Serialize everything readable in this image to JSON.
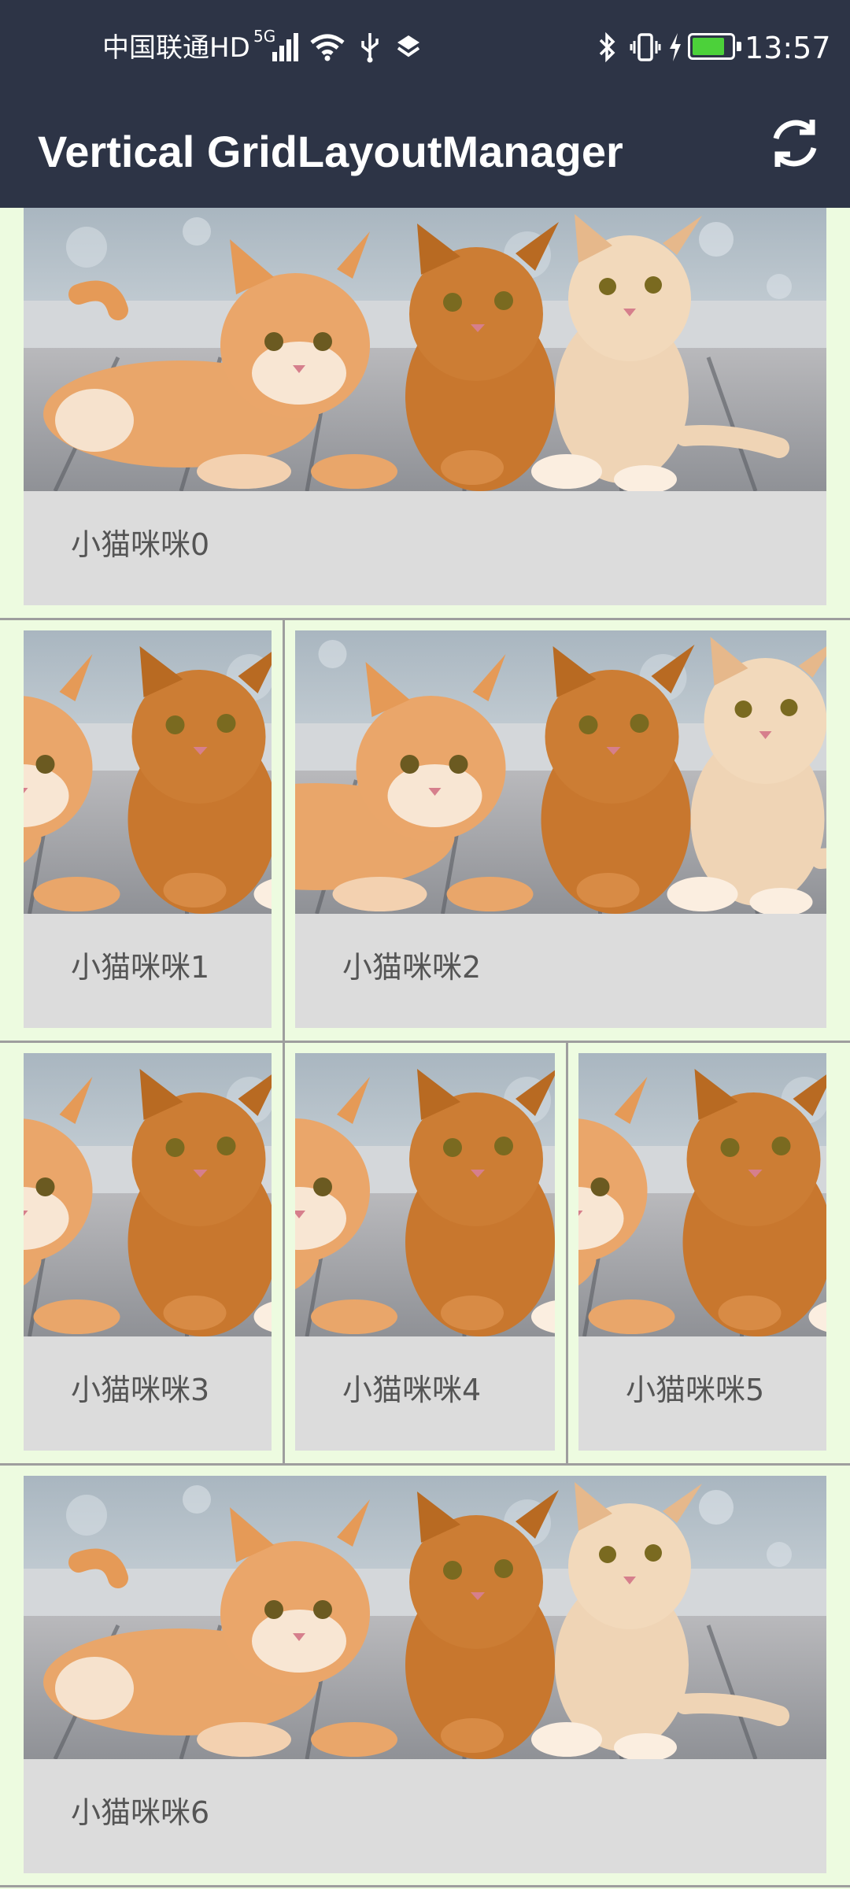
{
  "status_bar": {
    "carrier": "中国联通HD",
    "network": "5G",
    "time": "13:57",
    "battery_color": "#4cd13a",
    "icons": [
      "signal-icon",
      "wifi-icon",
      "usb-icon",
      "layers-icon",
      "bluetooth-icon",
      "vibrate-icon",
      "charging-icon",
      "battery-icon"
    ]
  },
  "toolbar": {
    "title": "Vertical GridLayoutManager",
    "refresh_icon": "refresh-icon"
  },
  "grid": {
    "items": [
      {
        "label": "小猫咪咪0"
      },
      {
        "label": "小猫咪咪1"
      },
      {
        "label": "小猫咪咪2"
      },
      {
        "label": "小猫咪咪3"
      },
      {
        "label": "小猫咪咪4"
      },
      {
        "label": "小猫咪咪5"
      },
      {
        "label": "小猫咪咪6"
      }
    ]
  },
  "colors": {
    "toolbar_bg": "#2d3446",
    "page_bg": "#edfbe0",
    "card_label_bg": "#dcdcdc"
  }
}
